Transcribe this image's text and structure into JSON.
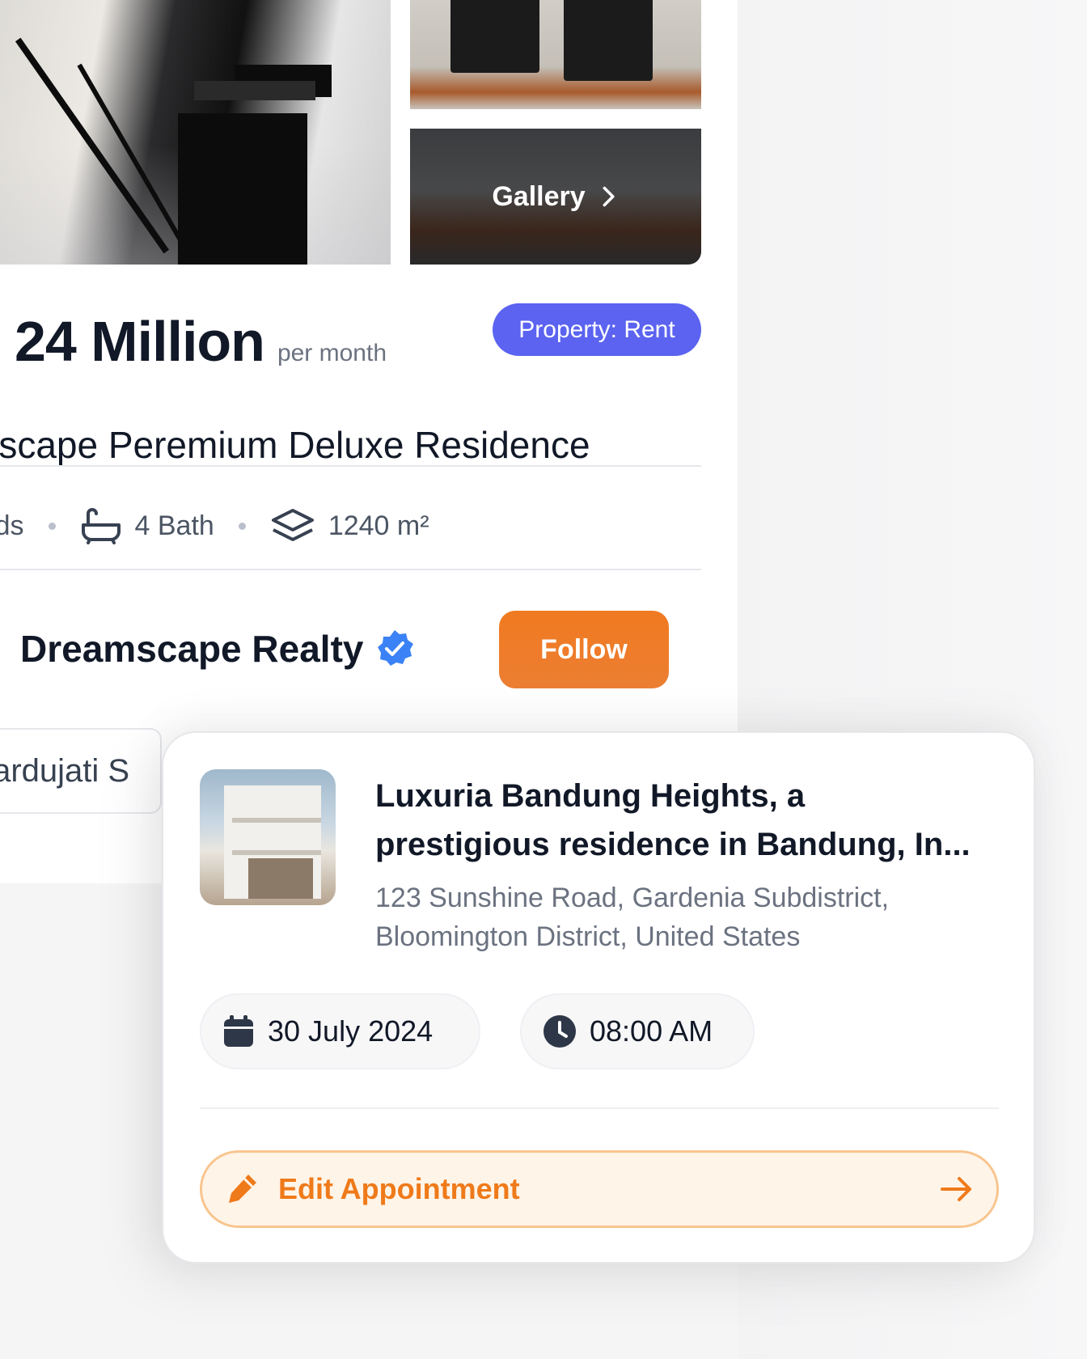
{
  "gallery": {
    "label": "Gallery"
  },
  "listing": {
    "price": "24 Million",
    "price_unit": "per month",
    "badge": "Property: Rent",
    "title": "mscape Peremium Deluxe Residence",
    "features": {
      "beds": "Beds",
      "baths": "4 Bath",
      "area": "1240 m²"
    }
  },
  "agent": {
    "name": "Dreamscape Realty",
    "follow_label": "Follow",
    "address_partial": "Gardujati S"
  },
  "appointment": {
    "title_line1": "Luxuria Bandung Heights, a",
    "title_line2": "prestigious residence in Bandung, In...",
    "address_line1": "123 Sunshine Road, Gardenia Subdistrict,",
    "address_line2": "Bloomington District, United States",
    "date": "30 July 2024",
    "time": "08:00 AM",
    "edit_label": "Edit Appointment"
  },
  "colors": {
    "accent_orange": "#EF7A1A",
    "badge_indigo": "#5B63F0",
    "verified_blue": "#3B82F6"
  }
}
